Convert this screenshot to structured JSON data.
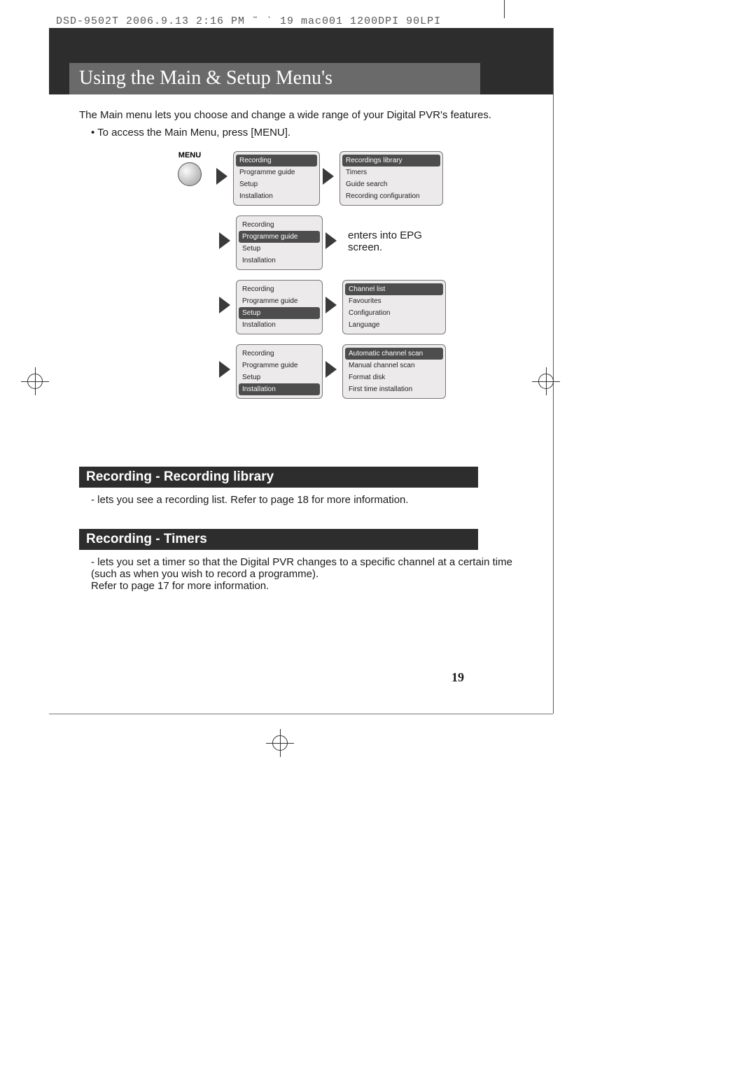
{
  "print_header": "DSD-9502T  2006.9.13 2:16 PM  ˜   ` 19   mac001  1200DPI 90LPI",
  "page_title": "Using the Main & Setup Menu's",
  "intro_text": "The Main menu lets you choose and change a wide range of your Digital PVR's features.",
  "bullet_text": "To access the Main Menu, press [MENU].",
  "menu_button_label": "MENU",
  "rows": [
    {
      "left_items": [
        "Recording",
        "Programme guide",
        "Setup",
        "Installation"
      ],
      "left_selected_index": 0,
      "right_items": [
        "Recordings library",
        "Timers",
        "Guide search",
        "Recording configuration"
      ],
      "right_selected_index": 0,
      "right_is_text": false
    },
    {
      "left_items": [
        "Recording",
        "Programme guide",
        "Setup",
        "Installation"
      ],
      "left_selected_index": 1,
      "right_text": "enters into EPG screen.",
      "right_is_text": true
    },
    {
      "left_items": [
        "Recording",
        "Programme guide",
        "Setup",
        "Installation"
      ],
      "left_selected_index": 2,
      "right_items": [
        "Channel list",
        "Favourites",
        "Configuration",
        "Language"
      ],
      "right_selected_index": 0,
      "right_is_text": false
    },
    {
      "left_items": [
        "Recording",
        "Programme guide",
        "Setup",
        "Installation"
      ],
      "left_selected_index": 3,
      "right_items": [
        "Automatic channel scan",
        "Manual channel scan",
        "Format disk",
        "First time installation"
      ],
      "right_selected_index": 0,
      "right_is_text": false
    }
  ],
  "section1_title": "Recording - Recording library",
  "section1_desc": "lets you see a recording list. Refer to page 18 for more information.",
  "section2_title": "Recording - Timers",
  "section2_desc": "lets you set a timer so that the Digital PVR changes to a specific channel at a certain time (such as when you wish to record a programme).\nRefer to page 17 for more information.",
  "page_number": "19"
}
